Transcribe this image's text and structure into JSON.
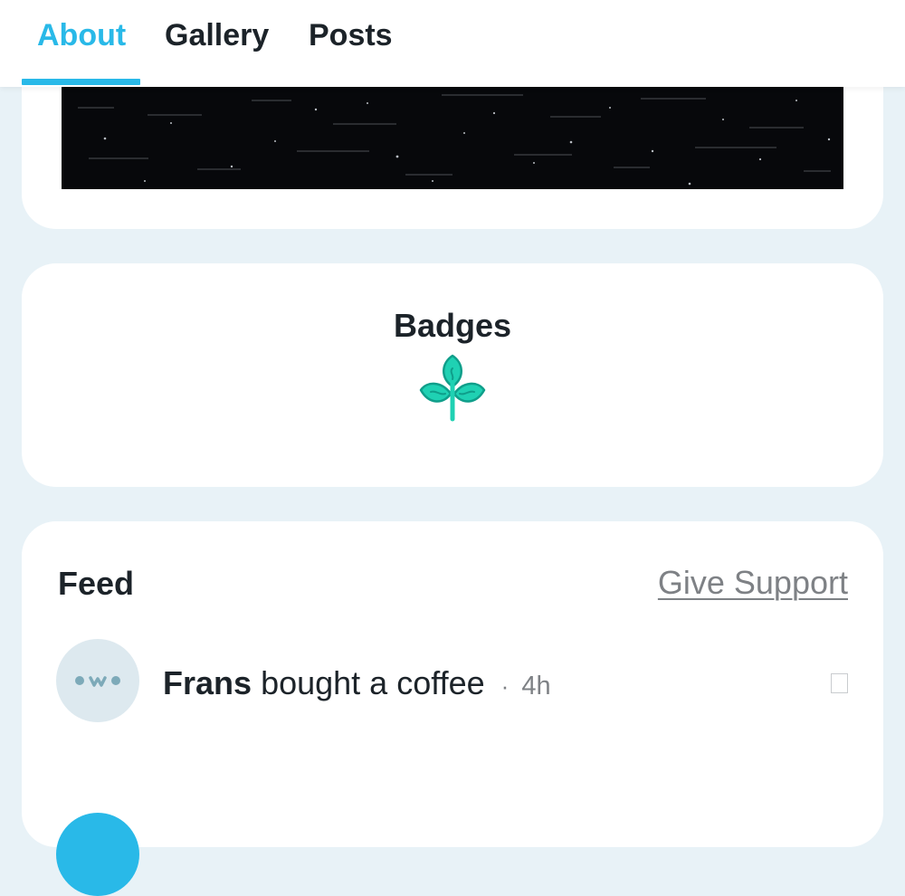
{
  "tabs": {
    "items": [
      {
        "label": "About",
        "active": true
      },
      {
        "label": "Gallery",
        "active": false
      },
      {
        "label": "Posts",
        "active": false
      }
    ],
    "active_color": "#29b9e8"
  },
  "badges": {
    "title": "Badges",
    "icon": "plant-sprout-icon",
    "icon_color": "#1fcfb2"
  },
  "feed": {
    "title": "Feed",
    "give_support_label": "Give Support",
    "items": [
      {
        "name": "Frans",
        "action": "bought a coffee",
        "separator": "·",
        "time": "4h",
        "avatar_icon": "owo-face-icon"
      }
    ]
  },
  "colors": {
    "background": "#e8f2f7",
    "text": "#1c2329",
    "muted": "#7e8185"
  }
}
